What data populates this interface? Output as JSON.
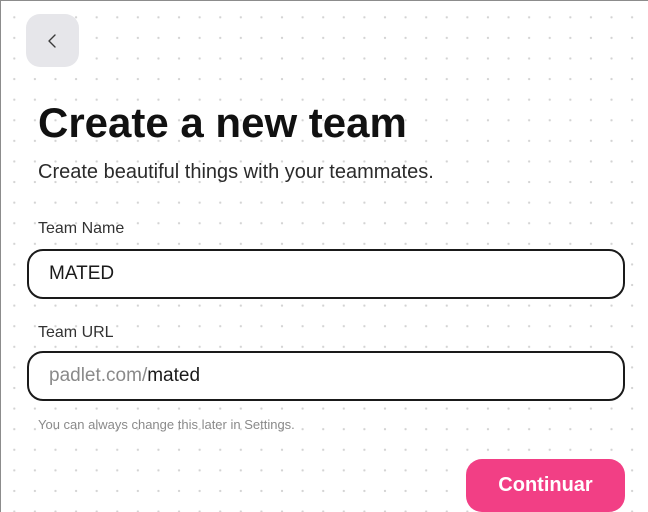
{
  "header": {
    "back_icon": "chevron-left-icon",
    "title": "Create a new team",
    "subtitle": "Create beautiful things with your teammates."
  },
  "form": {
    "team_name": {
      "label": "Team Name",
      "value": "MATED"
    },
    "team_url": {
      "label": "Team URL",
      "prefix": "padlet.com/",
      "value": "mated",
      "hint": "You can always change this later in Settings."
    }
  },
  "actions": {
    "continue_label": "Continuar"
  },
  "colors": {
    "accent": "#f23f85",
    "back_button_bg": "#e6e6ea",
    "field_border": "#1a1a1a"
  }
}
